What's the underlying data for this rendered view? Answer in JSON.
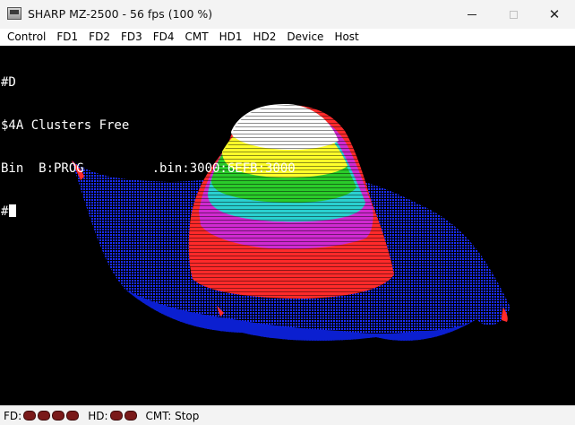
{
  "window": {
    "title": "SHARP MZ-2500 - 56 fps (100 %)",
    "icon": "computer-icon",
    "controls": {
      "minimize": "─",
      "maximize": "☐",
      "close": "✕"
    }
  },
  "menu": [
    "Control",
    "FD1",
    "FD2",
    "FD3",
    "FD4",
    "CMT",
    "HD1",
    "HD2",
    "Device",
    "Host"
  ],
  "terminal": {
    "lines": [
      "#D",
      "$4A Clusters Free",
      "Bin  B:PROG         .bin:3000:6EFB:3000",
      "#"
    ]
  },
  "status": {
    "fd_label": "FD:",
    "fd_leds": 4,
    "hd_label": "HD:",
    "hd_leds": 2,
    "cmt_text": "CMT: Stop"
  },
  "colors": {
    "screen_bg": "#000000",
    "led": "#7a1a1a",
    "plot_base": "#1a2cff",
    "plot_bands": [
      "#ff2a2a",
      "#d02ad0",
      "#2ad0d0",
      "#2acb2a",
      "#ffff2a",
      "#ffffff"
    ]
  }
}
